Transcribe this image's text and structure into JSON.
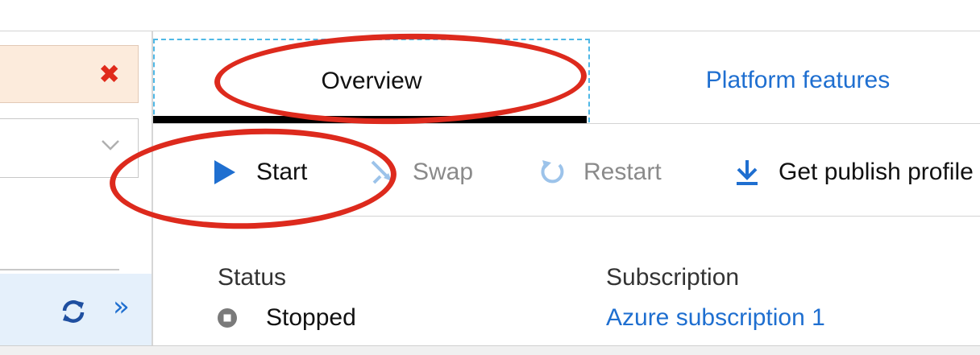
{
  "tabs": {
    "overview": "Overview",
    "platform_features": "Platform features"
  },
  "toolbar": {
    "start": "Start",
    "swap": "Swap",
    "restart": "Restart",
    "get_publish_profile": "Get publish profile"
  },
  "essentials": {
    "status_label": "Status",
    "status_value": "Stopped",
    "subscription_label": "Subscription",
    "subscription_value": "Azure subscription 1"
  },
  "icons": {
    "error_close": "✖",
    "expand": "»"
  },
  "colors": {
    "link_blue": "#1f6fd0",
    "annotation_red": "#dd2a1d",
    "error_bg": "#fcebdc",
    "disabled_gray": "#8a8a8a"
  }
}
